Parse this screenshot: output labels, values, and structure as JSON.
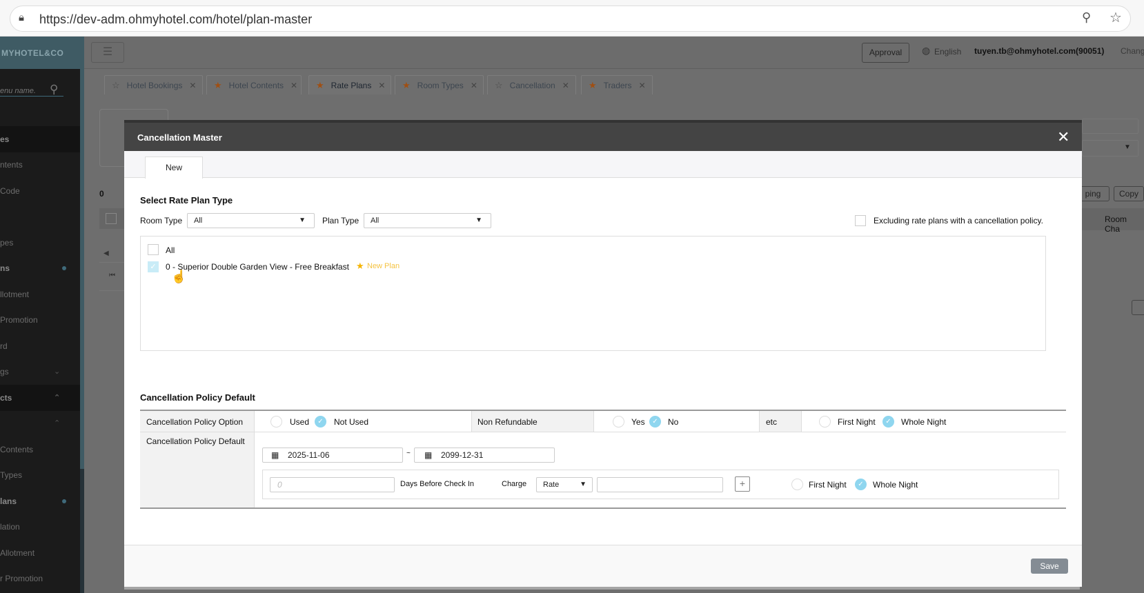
{
  "browser": {
    "url": "https://dev-adm.ohmyhotel.com/hotel/plan-master"
  },
  "header": {
    "logo": "MYHOTEL&CO",
    "approval": "Approval",
    "language": "English",
    "user": "tuyen.tb@ohmyhotel.com(90051)",
    "change": "Chang"
  },
  "sidebar": {
    "search_placeholder": "enu name.",
    "items": [
      {
        "label": "es",
        "bold": true
      },
      {
        "label": "ntents"
      },
      {
        "label": "Code"
      },
      {
        "label": ""
      },
      {
        "label": "pes"
      },
      {
        "label": "ns",
        "bold": true
      },
      {
        "label": "llotment"
      },
      {
        "label": "Promotion"
      },
      {
        "label": "rd"
      },
      {
        "label": "gs"
      },
      {
        "label": "cts",
        "bold": true
      },
      {
        "label": ""
      },
      {
        "label": "Contents"
      },
      {
        "label": "Types"
      },
      {
        "label": "lans",
        "bold": true
      },
      {
        "label": "lation"
      },
      {
        "label": "Allotment"
      },
      {
        "label": "r Promotion"
      }
    ]
  },
  "tabs": [
    {
      "label": "Hotel Bookings",
      "starred": false
    },
    {
      "label": "Hotel Contents",
      "starred": true
    },
    {
      "label": "Rate Plans",
      "starred": true,
      "active": true
    },
    {
      "label": "Room Types",
      "starred": true
    },
    {
      "label": "Cancellation",
      "starred": false
    },
    {
      "label": "Traders",
      "starred": true
    }
  ],
  "background": {
    "count": "0",
    "mapping_btn": "ping",
    "copy_btn": "Copy",
    "col_room_charge": "Room Cha"
  },
  "modal": {
    "title": "Cancellation Master",
    "tab": "New",
    "select_section": {
      "title": "Select Rate Plan Type",
      "room_type_label": "Room Type",
      "room_type_value": "All",
      "plan_type_label": "Plan Type",
      "plan_type_value": "All",
      "exclude_label": "Excluding rate plans with a cancellation policy.",
      "all_label": "All",
      "plans": [
        {
          "label": "0 - Superior Double Garden View - Free Breakfast",
          "badge": "New Plan",
          "checked": true
        }
      ]
    },
    "policy": {
      "title": "Cancellation Policy Default",
      "option_label": "Cancellation Policy Option",
      "used": "Used",
      "not_used": "Not Used",
      "non_refundable_label": "Non Refundable",
      "yes": "Yes",
      "no": "No",
      "etc_label": "etc",
      "first_night": "First Night",
      "whole_night": "Whole Night",
      "default_label": "Cancellation Policy Default",
      "date_from": "2025-11-06",
      "date_to": "2099-12-31",
      "tilde": "~",
      "days_placeholder": "0",
      "days_label": "Days Before Check In",
      "charge_label": "Charge",
      "charge_type": "Rate",
      "plus": "+"
    },
    "save": "Save"
  }
}
